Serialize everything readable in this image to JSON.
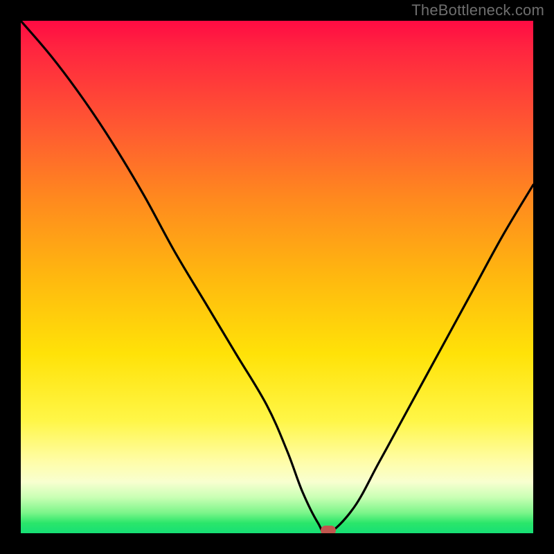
{
  "watermark": "TheBottleneck.com",
  "chart_data": {
    "type": "line",
    "title": "",
    "xlabel": "",
    "ylabel": "",
    "xlim": [
      0,
      100
    ],
    "ylim": [
      0,
      100
    ],
    "grid": false,
    "background": "red-yellow-green vertical gradient",
    "series": [
      {
        "name": "bottleneck-curve",
        "x": [
          0,
          6,
          12,
          18,
          24,
          30,
          36,
          42,
          48,
          52,
          55,
          58,
          60,
          65,
          70,
          76,
          82,
          88,
          94,
          100
        ],
        "values": [
          100,
          93,
          85,
          76,
          66,
          55,
          45,
          35,
          25,
          16,
          8,
          2,
          0,
          5,
          14,
          25,
          36,
          47,
          58,
          68
        ]
      }
    ],
    "marker": {
      "x": 60,
      "y": 0.6,
      "color": "#c1564e"
    },
    "colors": {
      "curve": "#000000",
      "frame": "#000000",
      "gradient_top": "#ff0b43",
      "gradient_mid": "#ffe208",
      "gradient_bottom": "#16df75"
    }
  }
}
